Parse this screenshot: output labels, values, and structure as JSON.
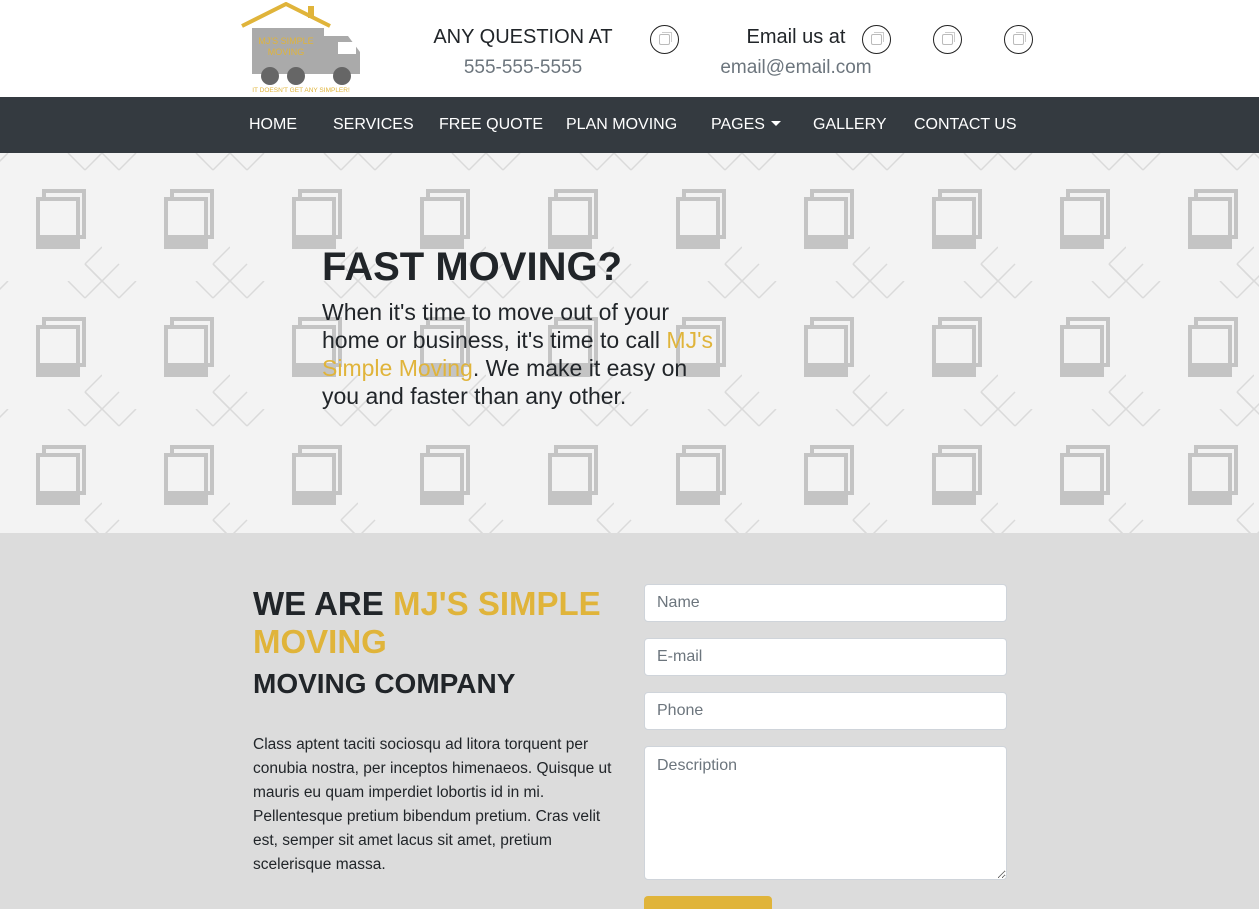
{
  "header": {
    "logo_text": "MJ'S SIMPLE MOVING",
    "logo_tagline": "IT DOESN'T GET ANY SIMPLER!",
    "phone_title": "ANY QUESTION AT",
    "phone_value": "555-555-5555",
    "email_title": "Email us at",
    "email_value": "email@email.com"
  },
  "nav": {
    "items": [
      "HOME",
      "SERVICES",
      "FREE QUOTE",
      "PLAN MOVING",
      "PAGES",
      "GALLERY",
      "CONTACT US"
    ]
  },
  "hero": {
    "title": "FAST MOVING?",
    "text_before": "When it's time to move out of your home or business, it's time to call ",
    "brand": "MJ's Simple Moving",
    "text_after": ". We make it easy on you and faster than any other."
  },
  "about": {
    "title_prefix": "WE ARE ",
    "title_accent": "MJ'S SIMPLE MOVING",
    "subtitle": "MOVING COMPANY",
    "body": "Class aptent taciti sociosqu ad litora torquent per conubia nostra, per inceptos himenaeos. Quisque ut mauris eu quam imperdiet lobortis id in mi. Pellentesque pretium bibendum pretium. Cras velit est, semper sit amet lacus sit amet, pretium scelerisque massa."
  },
  "form": {
    "name_placeholder": "Name",
    "email_placeholder": "E-mail",
    "phone_placeholder": "Phone",
    "description_placeholder": "Description"
  },
  "colors": {
    "accent": "#e0b43a",
    "nav_bg": "#343a40",
    "hero_bg": "#f3f3f3",
    "about_bg": "#dcdcdc"
  }
}
